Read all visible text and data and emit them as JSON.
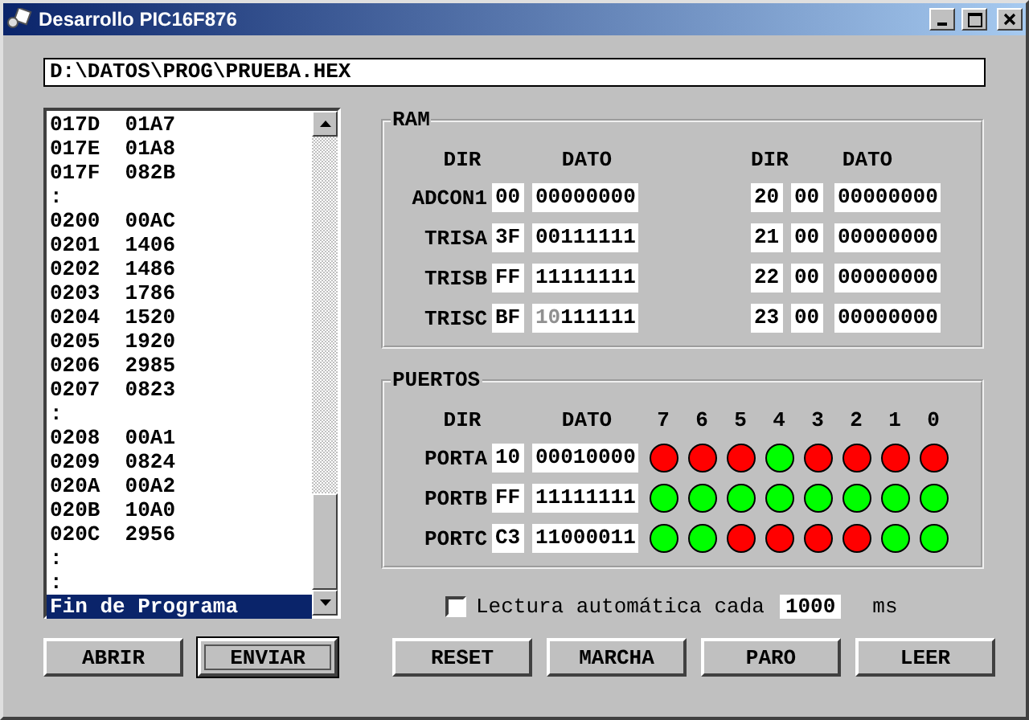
{
  "window": {
    "title": "Desarrollo PIC16F876"
  },
  "file_path": "D:\\DATOS\\PROG\\PRUEBA.HEX",
  "program_list": [
    {
      "text": "017D  01A7",
      "selected": false
    },
    {
      "text": "017E  01A8",
      "selected": false
    },
    {
      "text": "017F  082B",
      "selected": false
    },
    {
      "text": ":",
      "selected": false
    },
    {
      "text": "0200  00AC",
      "selected": false
    },
    {
      "text": "0201  1406",
      "selected": false
    },
    {
      "text": "0202  1486",
      "selected": false
    },
    {
      "text": "0203  1786",
      "selected": false
    },
    {
      "text": "0204  1520",
      "selected": false
    },
    {
      "text": "0205  1920",
      "selected": false
    },
    {
      "text": "0206  2985",
      "selected": false
    },
    {
      "text": "0207  0823",
      "selected": false
    },
    {
      "text": ":",
      "selected": false
    },
    {
      "text": "0208  00A1",
      "selected": false
    },
    {
      "text": "0209  0824",
      "selected": false
    },
    {
      "text": "020A  00A2",
      "selected": false
    },
    {
      "text": "020B  10A0",
      "selected": false
    },
    {
      "text": "020C  2956",
      "selected": false
    },
    {
      "text": ":",
      "selected": false
    },
    {
      "text": ":",
      "selected": false
    },
    {
      "text": "Fin de Programa",
      "selected": true
    }
  ],
  "ram": {
    "title": "RAM",
    "headers": [
      "DIR",
      "DATO",
      "DIR",
      "DATO"
    ],
    "left_rows": [
      {
        "name": "ADCON1",
        "dir": "00",
        "dato": "00000000"
      },
      {
        "name": "TRISA",
        "dir": "3F",
        "dato": "00111111"
      },
      {
        "name": "TRISB",
        "dir": "FF",
        "dato": "11111111"
      },
      {
        "name": "TRISC",
        "dir": "BF",
        "dato_dim": "10",
        "dato": "111111"
      }
    ],
    "right_rows": [
      {
        "address": "20",
        "dir": "00",
        "dato": "00000000"
      },
      {
        "address": "21",
        "dir": "00",
        "dato": "00000000"
      },
      {
        "address": "22",
        "dir": "00",
        "dato": "00000000"
      },
      {
        "address": "23",
        "dir": "00",
        "dato": "00000000"
      }
    ]
  },
  "puertos": {
    "title": "PUERTOS",
    "headers": [
      "DIR",
      "DATO"
    ],
    "bits": [
      "7",
      "6",
      "5",
      "4",
      "3",
      "2",
      "1",
      "0"
    ],
    "rows": [
      {
        "name": "PORTA",
        "dir": "10",
        "dato": "00010000",
        "leds": [
          false,
          false,
          false,
          true,
          false,
          false,
          false,
          false
        ]
      },
      {
        "name": "PORTB",
        "dir": "FF",
        "dato": "11111111",
        "leds": [
          true,
          true,
          true,
          true,
          true,
          true,
          true,
          true
        ]
      },
      {
        "name": "PORTC",
        "dir": "C3",
        "dato": "11000011",
        "leds": [
          true,
          true,
          false,
          false,
          false,
          false,
          true,
          true
        ]
      }
    ]
  },
  "auto_read": {
    "label": "Lectura automática cada",
    "checked": false,
    "value": "1000",
    "unit": "ms"
  },
  "left_buttons": [
    {
      "label": "ABRIR",
      "focused": false
    },
    {
      "label": "ENVIAR",
      "focused": true
    }
  ],
  "right_buttons": [
    {
      "label": "RESET",
      "focused": false
    },
    {
      "label": "MARCHA",
      "focused": false
    },
    {
      "label": "PARO",
      "focused": false
    },
    {
      "label": "LEER",
      "focused": false
    }
  ]
}
